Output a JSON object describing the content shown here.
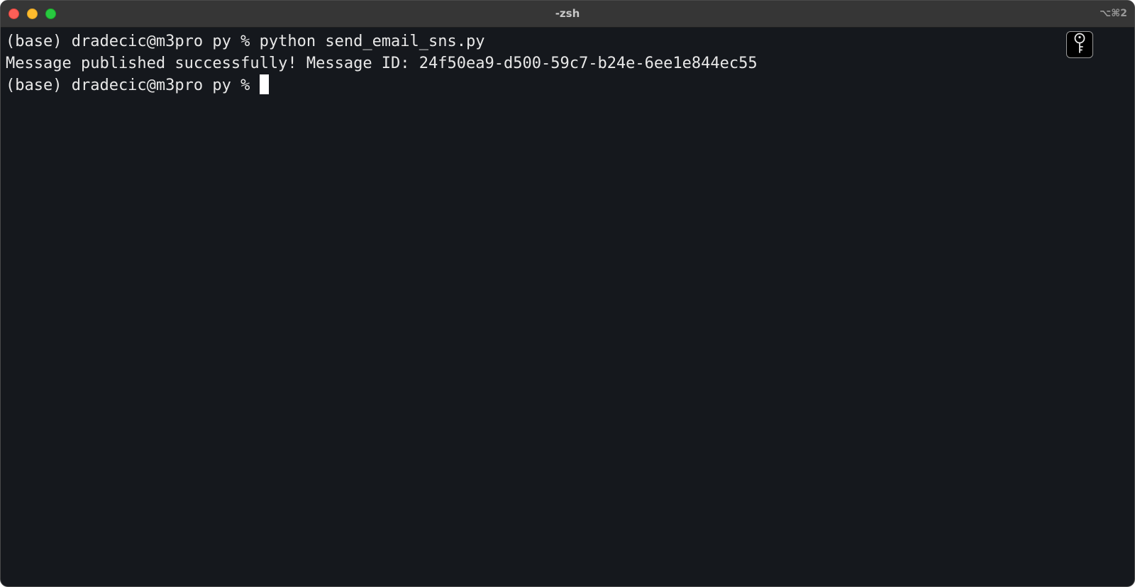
{
  "window": {
    "title": "-zsh",
    "shortcut": "⌥⌘2"
  },
  "terminal": {
    "lines": [
      {
        "prompt": "(base) dradecic@m3pro py % ",
        "command": "python send_email_sns.py"
      },
      {
        "output": "Message published successfully! Message ID: 24f50ea9-d500-59c7-b24e-6ee1e844ec55"
      },
      {
        "prompt": "(base) dradecic@m3pro py % ",
        "command": ""
      }
    ]
  },
  "icons": {
    "password_button": "key-icon"
  },
  "colors": {
    "background": "#15181d",
    "titlebar": "#363636",
    "text": "#e8e8e8",
    "close": "#fe5f57",
    "minimize": "#febc2e",
    "zoom": "#28c840"
  }
}
